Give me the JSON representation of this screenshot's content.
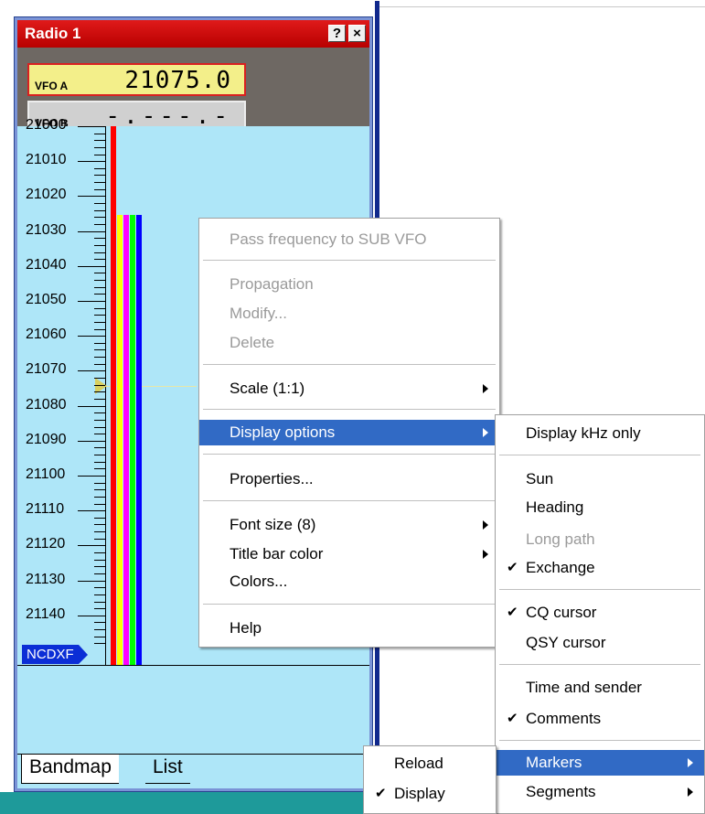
{
  "window": {
    "title": "Radio 1",
    "help_label": "?",
    "close_label": "×"
  },
  "vfo": {
    "a_label": "VFO A",
    "a_value": "21075.0",
    "b_label": "VFO B",
    "b_value": "-.---.-"
  },
  "scale": [
    "21000",
    "21010",
    "21020",
    "21030",
    "21040",
    "21050",
    "21060",
    "21070",
    "21080",
    "21090",
    "21100",
    "21110",
    "21120",
    "21130",
    "21140"
  ],
  "bandmap": {
    "ncdxf_label": "NCDXF",
    "marker_colors": [
      "#ff0000",
      "#ffff00",
      "#ff00ff",
      "#00ff00",
      "#0000ff"
    ]
  },
  "tabs": {
    "bandmap": "Bandmap",
    "list": "List"
  },
  "context_menu": {
    "pass_frequency": "Pass frequency to SUB VFO",
    "propagation": "Propagation",
    "modify": "Modify...",
    "delete": "Delete",
    "scale": "Scale (1:1)",
    "display_options": "Display options",
    "properties": "Properties...",
    "font_size": "Font size (8)",
    "title_bar_color": "Title bar color",
    "colors": "Colors...",
    "help": "Help"
  },
  "display_submenu": {
    "display_khz_only": "Display kHz only",
    "sun": "Sun",
    "heading": "Heading",
    "long_path": "Long path",
    "exchange": "Exchange",
    "cq_cursor": "CQ cursor",
    "qsy_cursor": "QSY cursor",
    "time_and_sender": "Time and sender",
    "comments": "Comments",
    "markers": "Markers",
    "segments": "Segments"
  },
  "markers_submenu": {
    "reload": "Reload",
    "display": "Display"
  },
  "check_glyph": "✔"
}
